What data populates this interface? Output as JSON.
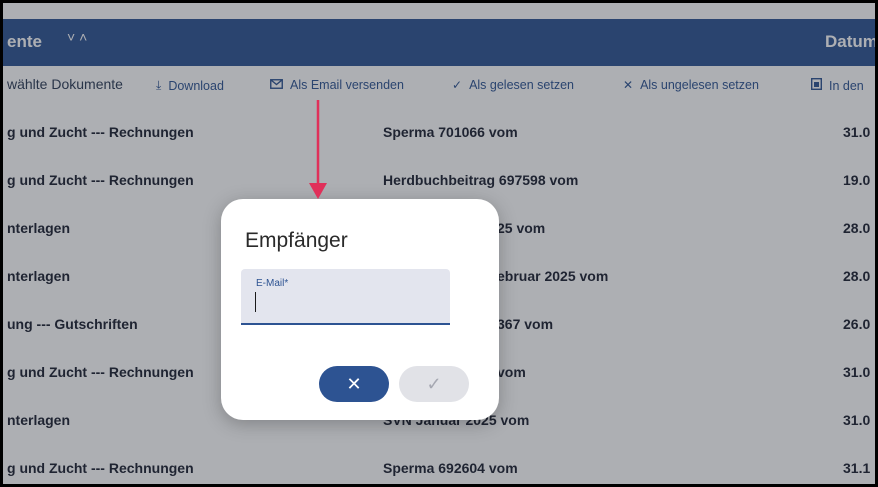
{
  "header": {
    "title": "ente",
    "sort_icons": "˅˄",
    "date_col": "Datum"
  },
  "toolbar": {
    "selected_label": "wählte Dokumente",
    "download": {
      "label": "Download",
      "icon": "download-icon"
    },
    "email": {
      "label": "Als Email versenden",
      "icon": "mail-icon"
    },
    "read": {
      "label": "Als gelesen setzen",
      "icon": "check-icon"
    },
    "unread": {
      "label": "Als ungelesen setzen",
      "icon": "close-icon"
    },
    "move": {
      "label": "In den",
      "icon": "folder-move-icon"
    }
  },
  "rows": [
    {
      "c1": "g und Zucht --- Rechnungen",
      "c2": "Sperma 701066 vom",
      "c3": "31.0"
    },
    {
      "c1": "g und Zucht --- Rechnungen",
      "c2": "Herdbuchbeitrag 697598 vom",
      "c3": "19.0"
    },
    {
      "c1": "nterlagen",
      "c2": "25 vom",
      "c3": "28.0"
    },
    {
      "c1": "nterlagen",
      "c2": "ebruar 2025 vom",
      "c3": "28.0"
    },
    {
      "c1": "ung --- Gutschriften",
      "c2": "367 vom",
      "c3": "26.0"
    },
    {
      "c1": "g und Zucht --- Rechnungen",
      "c2": "vom",
      "c3": "31.0"
    },
    {
      "c1": "nterlagen",
      "c2": "SVN Januar 2025 vom",
      "c3": "31.0"
    },
    {
      "c1": "g und Zucht --- Rechnungen",
      "c2": "Sperma 692604 vom",
      "c3": "31.1"
    }
  ],
  "dialog": {
    "title": "Empfänger",
    "field_label": "E-Mail*",
    "field_value": "",
    "cancel_symbol": "✕",
    "confirm_symbol": "✓"
  },
  "colors": {
    "primary": "#2d5392",
    "annotation_arrow": "#e0305a"
  }
}
